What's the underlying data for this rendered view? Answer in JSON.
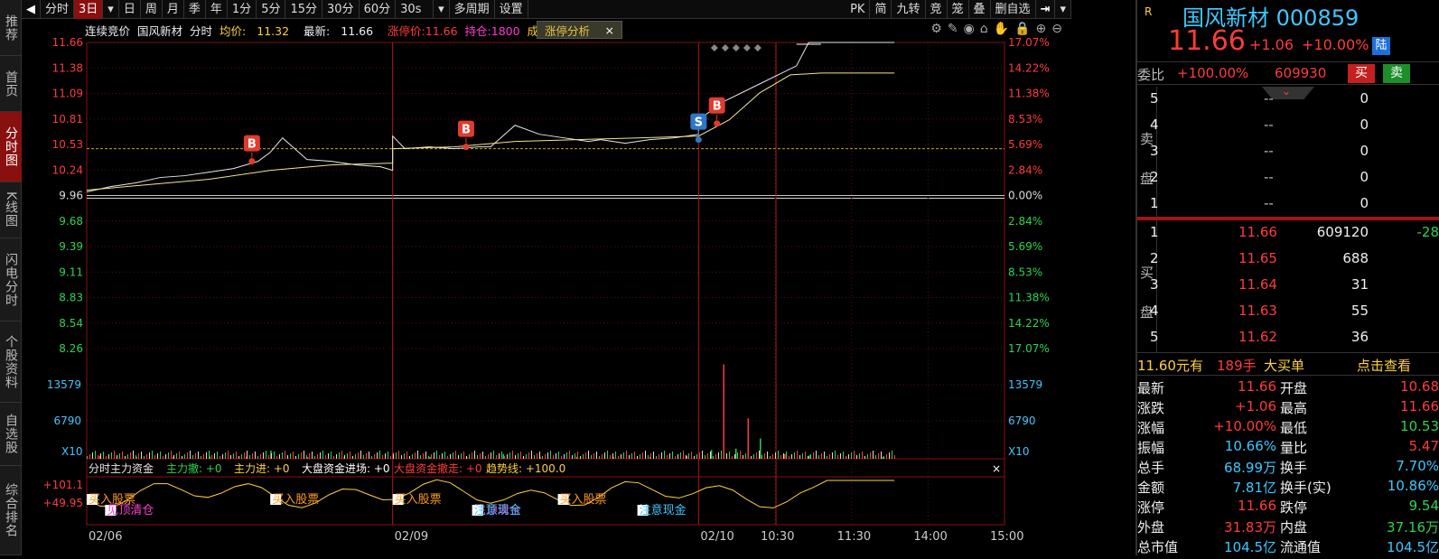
{
  "left_tabs": [
    "推荐",
    "首页",
    "分时图",
    "K线图",
    "闪电分时",
    "个股资料",
    "自选股",
    "综合排名"
  ],
  "toolbar": {
    "items": [
      "分时",
      "3日",
      "▾",
      "日",
      "周",
      "月",
      "季",
      "年",
      "1分",
      "5分",
      "15分",
      "30分",
      "60分",
      "30s",
      "▾",
      "多周期",
      "设置"
    ],
    "active": "3日",
    "right_items": [
      "PK",
      "简",
      "九转",
      "竞",
      "笼",
      "叠",
      "删自选"
    ]
  },
  "info_bar": {
    "auction": "连续竞价",
    "name": "国风新材",
    "mode": "分时",
    "avg_label": "均价:",
    "avg": "11.32",
    "last_label": "最新:",
    "last": "11.66",
    "limit_label": "涨停价:11.66",
    "hold_label": "持仓:1800",
    "cost_label": "成本",
    "tab": "涨停分析",
    "tab_close": "×"
  },
  "chart_data": {
    "type": "line",
    "title": "国风新材 分时",
    "x_ticks": [
      "02/06",
      "02/09",
      "02/10",
      "10:30",
      "11:30",
      "14:00",
      "15:00"
    ],
    "price_ticks": [
      "11.66",
      "11.38",
      "11.09",
      "10.81",
      "10.53",
      "10.24",
      "9.96",
      "9.68",
      "9.39",
      "9.11",
      "8.83",
      "8.54",
      "8.26"
    ],
    "pct_ticks": [
      "17.07%",
      "14.22%",
      "11.38%",
      "8.53%",
      "5.69%",
      "2.84%",
      "0.00%",
      "2.84%",
      "5.69%",
      "8.53%",
      "11.38%",
      "14.22%",
      "17.07%"
    ],
    "prev_close": 9.96,
    "price_ylim": [
      8.26,
      11.66
    ],
    "vol_ticks": [
      "13579",
      "6790"
    ],
    "vol_scale": "X10",
    "price_series": {
      "name": "最新",
      "x": [
        0,
        0.04,
        0.08,
        0.12,
        0.16,
        0.2,
        0.24,
        0.28,
        0.3,
        0.32,
        0.36,
        0.4,
        0.44,
        0.48,
        0.5,
        0.5,
        0.52,
        0.56,
        0.6,
        0.64,
        0.66,
        0.7,
        0.74,
        0.78,
        0.82,
        0.84,
        0.88,
        0.92,
        0.96,
        1.0,
        1.0,
        1.04,
        1.1,
        1.16,
        1.18,
        1.2,
        1.24,
        1.27,
        1.28,
        1.3,
        1.32
      ],
      "y": [
        10.0,
        10.06,
        10.1,
        10.16,
        10.18,
        10.22,
        10.26,
        10.34,
        10.44,
        10.6,
        10.36,
        10.34,
        10.3,
        10.28,
        10.24,
        10.62,
        10.48,
        10.5,
        10.48,
        10.5,
        10.5,
        10.74,
        10.64,
        10.6,
        10.56,
        10.58,
        10.54,
        10.58,
        10.6,
        10.64,
        10.8,
        11.0,
        11.2,
        11.4,
        11.66,
        11.66,
        11.66,
        11.66,
        11.66,
        11.66,
        11.66
      ]
    },
    "avg_series": {
      "name": "均价",
      "x": [
        0,
        0.1,
        0.2,
        0.3,
        0.4,
        0.5,
        0.5,
        0.6,
        0.7,
        0.8,
        0.9,
        1.0,
        1.05,
        1.1,
        1.15,
        1.2,
        1.32
      ],
      "y": [
        10.02,
        10.08,
        10.14,
        10.24,
        10.3,
        10.32,
        10.48,
        10.5,
        10.56,
        10.58,
        10.6,
        10.62,
        10.8,
        11.1,
        11.3,
        11.32,
        11.32
      ]
    },
    "markers": [
      {
        "label": "B",
        "x": 0.27,
        "y": 10.34
      },
      {
        "label": "B",
        "x": 0.62,
        "y": 10.5
      },
      {
        "label": "S",
        "x": 1.0,
        "y": 10.58
      },
      {
        "label": "B",
        "x": 1.03,
        "y": 10.76
      }
    ],
    "volume": {
      "x": [
        0.02,
        0.08,
        0.14,
        0.2,
        0.26,
        0.3,
        0.36,
        0.42,
        0.5,
        0.56,
        0.62,
        0.68,
        0.74,
        0.8,
        0.86,
        0.92,
        0.98,
        1.02,
        1.04,
        1.06,
        1.08,
        1.1,
        1.14,
        1.18,
        1.24,
        1.3
      ],
      "v": [
        400,
        300,
        250,
        350,
        300,
        1200,
        250,
        300,
        900,
        300,
        250,
        700,
        250,
        300,
        250,
        300,
        400,
        1300,
        14000,
        1500,
        6000,
        3000,
        700,
        500,
        350,
        250
      ]
    }
  },
  "indicator": {
    "title": "分时主力资金",
    "items": [
      "主力撤: +0",
      "主力进: +0",
      "大盘资金进场: +0",
      "大盘资金撤走: +0",
      "趋势线: +100.0"
    ],
    "y_ticks": [
      "+101.1",
      "+49.95"
    ],
    "signals": [
      "买入股票",
      "见顶清仓",
      "买入股票",
      "买入股票",
      "见顶清仓",
      "注意现金",
      "买入股票",
      "注意现金"
    ],
    "close": "×"
  },
  "right": {
    "flag": "R",
    "name": "国风新材",
    "code": "000859",
    "price": "11.66",
    "change": "+1.06",
    "pct": "+10.00%",
    "lu": "陆",
    "weibi_label": "委比",
    "weibi": "+100.00%",
    "weicha": "609930",
    "buy_btn": "买",
    "sell_btn": "卖",
    "sell_label": "卖\n盘",
    "buy_label": "买\n盘",
    "asks": [
      {
        "lvl": "5",
        "price": "--",
        "vol": "0"
      },
      {
        "lvl": "4",
        "price": "--",
        "vol": "0"
      },
      {
        "lvl": "3",
        "price": "--",
        "vol": "0"
      },
      {
        "lvl": "2",
        "price": "--",
        "vol": "0"
      },
      {
        "lvl": "1",
        "price": "--",
        "vol": "0"
      }
    ],
    "bids": [
      {
        "lvl": "1",
        "price": "11.66",
        "vol": "609120",
        "chg": "-28"
      },
      {
        "lvl": "2",
        "price": "11.65",
        "vol": "688",
        "chg": ""
      },
      {
        "lvl": "3",
        "price": "11.64",
        "vol": "31",
        "chg": ""
      },
      {
        "lvl": "4",
        "price": "11.63",
        "vol": "55",
        "chg": ""
      },
      {
        "lvl": "5",
        "price": "11.62",
        "vol": "36",
        "chg": ""
      }
    ],
    "bigorder": {
      "text1": "11.60元有",
      "text2": "189手",
      "text3": "大买单",
      "link": "点击查看"
    },
    "stats": [
      {
        "l1": "最新",
        "v1": "11.66",
        "c1": "red",
        "l2": "开盘",
        "v2": "10.68",
        "c2": "red"
      },
      {
        "l1": "涨跌",
        "v1": "+1.06",
        "c1": "red",
        "l2": "最高",
        "v2": "11.66",
        "c2": "red"
      },
      {
        "l1": "涨幅",
        "v1": "+10.00%",
        "c1": "red",
        "l2": "最低",
        "v2": "10.53",
        "c2": "green"
      },
      {
        "l1": "振幅",
        "v1": "10.66%",
        "c1": "cyan",
        "l2": "量比",
        "v2": "5.47",
        "c2": "red"
      },
      {
        "l1": "总手",
        "v1": "68.99万",
        "c1": "cyan",
        "l2": "换手",
        "v2": "7.70%",
        "c2": "cyan"
      },
      {
        "l1": "金额",
        "v1": "7.81亿",
        "c1": "cyan",
        "l2": "换手(实)",
        "v2": "10.86%",
        "c2": "cyan"
      },
      {
        "l1": "涨停",
        "v1": "11.66",
        "c1": "red",
        "l2": "跌停",
        "v2": "9.54",
        "c2": "green"
      },
      {
        "l1": "外盘",
        "v1": "31.83万",
        "c1": "red",
        "l2": "内盘",
        "v2": "37.16万",
        "c2": "green"
      },
      {
        "l1": "总市值",
        "v1": "104.5亿",
        "c1": "cyan",
        "l2": "流通值",
        "v2": "104.5亿",
        "c2": "cyan"
      }
    ]
  }
}
